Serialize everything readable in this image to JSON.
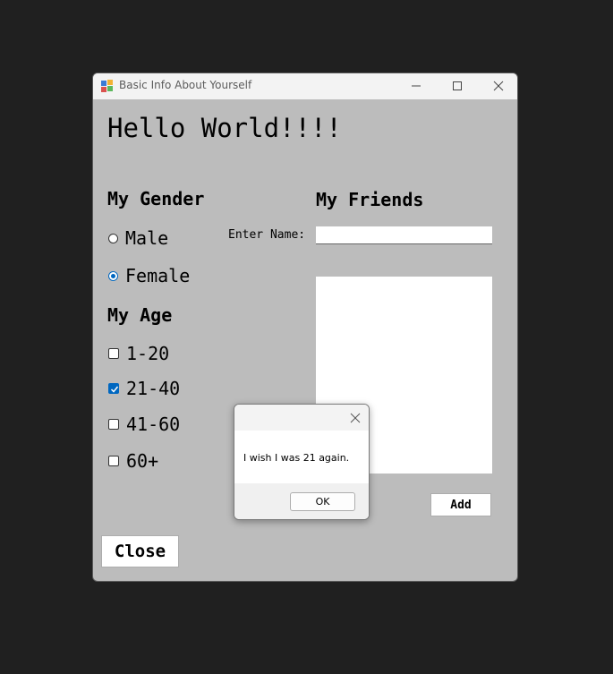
{
  "window": {
    "title": "Basic Info About Yourself",
    "icon": "app-icon"
  },
  "content": {
    "greeting": "Hello World!!!!",
    "gender": {
      "heading": "My Gender",
      "options": [
        {
          "label": "Male",
          "selected": false
        },
        {
          "label": "Female",
          "selected": true
        }
      ]
    },
    "age": {
      "heading": "My Age",
      "options": [
        {
          "label": "1-20",
          "checked": false
        },
        {
          "label": "21-40",
          "checked": true
        },
        {
          "label": "41-60",
          "checked": false
        },
        {
          "label": "60+",
          "checked": false
        }
      ]
    },
    "friends": {
      "heading": "My Friends",
      "name_label": "Enter Name:",
      "name_value": "",
      "items": [],
      "add_label": "Add"
    },
    "close_label": "Close"
  },
  "dialog": {
    "message": "I wish I was 21 again.",
    "ok_label": "OK"
  },
  "colors": {
    "accent": "#0067c0",
    "form_background": "#bcbcbc",
    "desktop": "#202020"
  }
}
